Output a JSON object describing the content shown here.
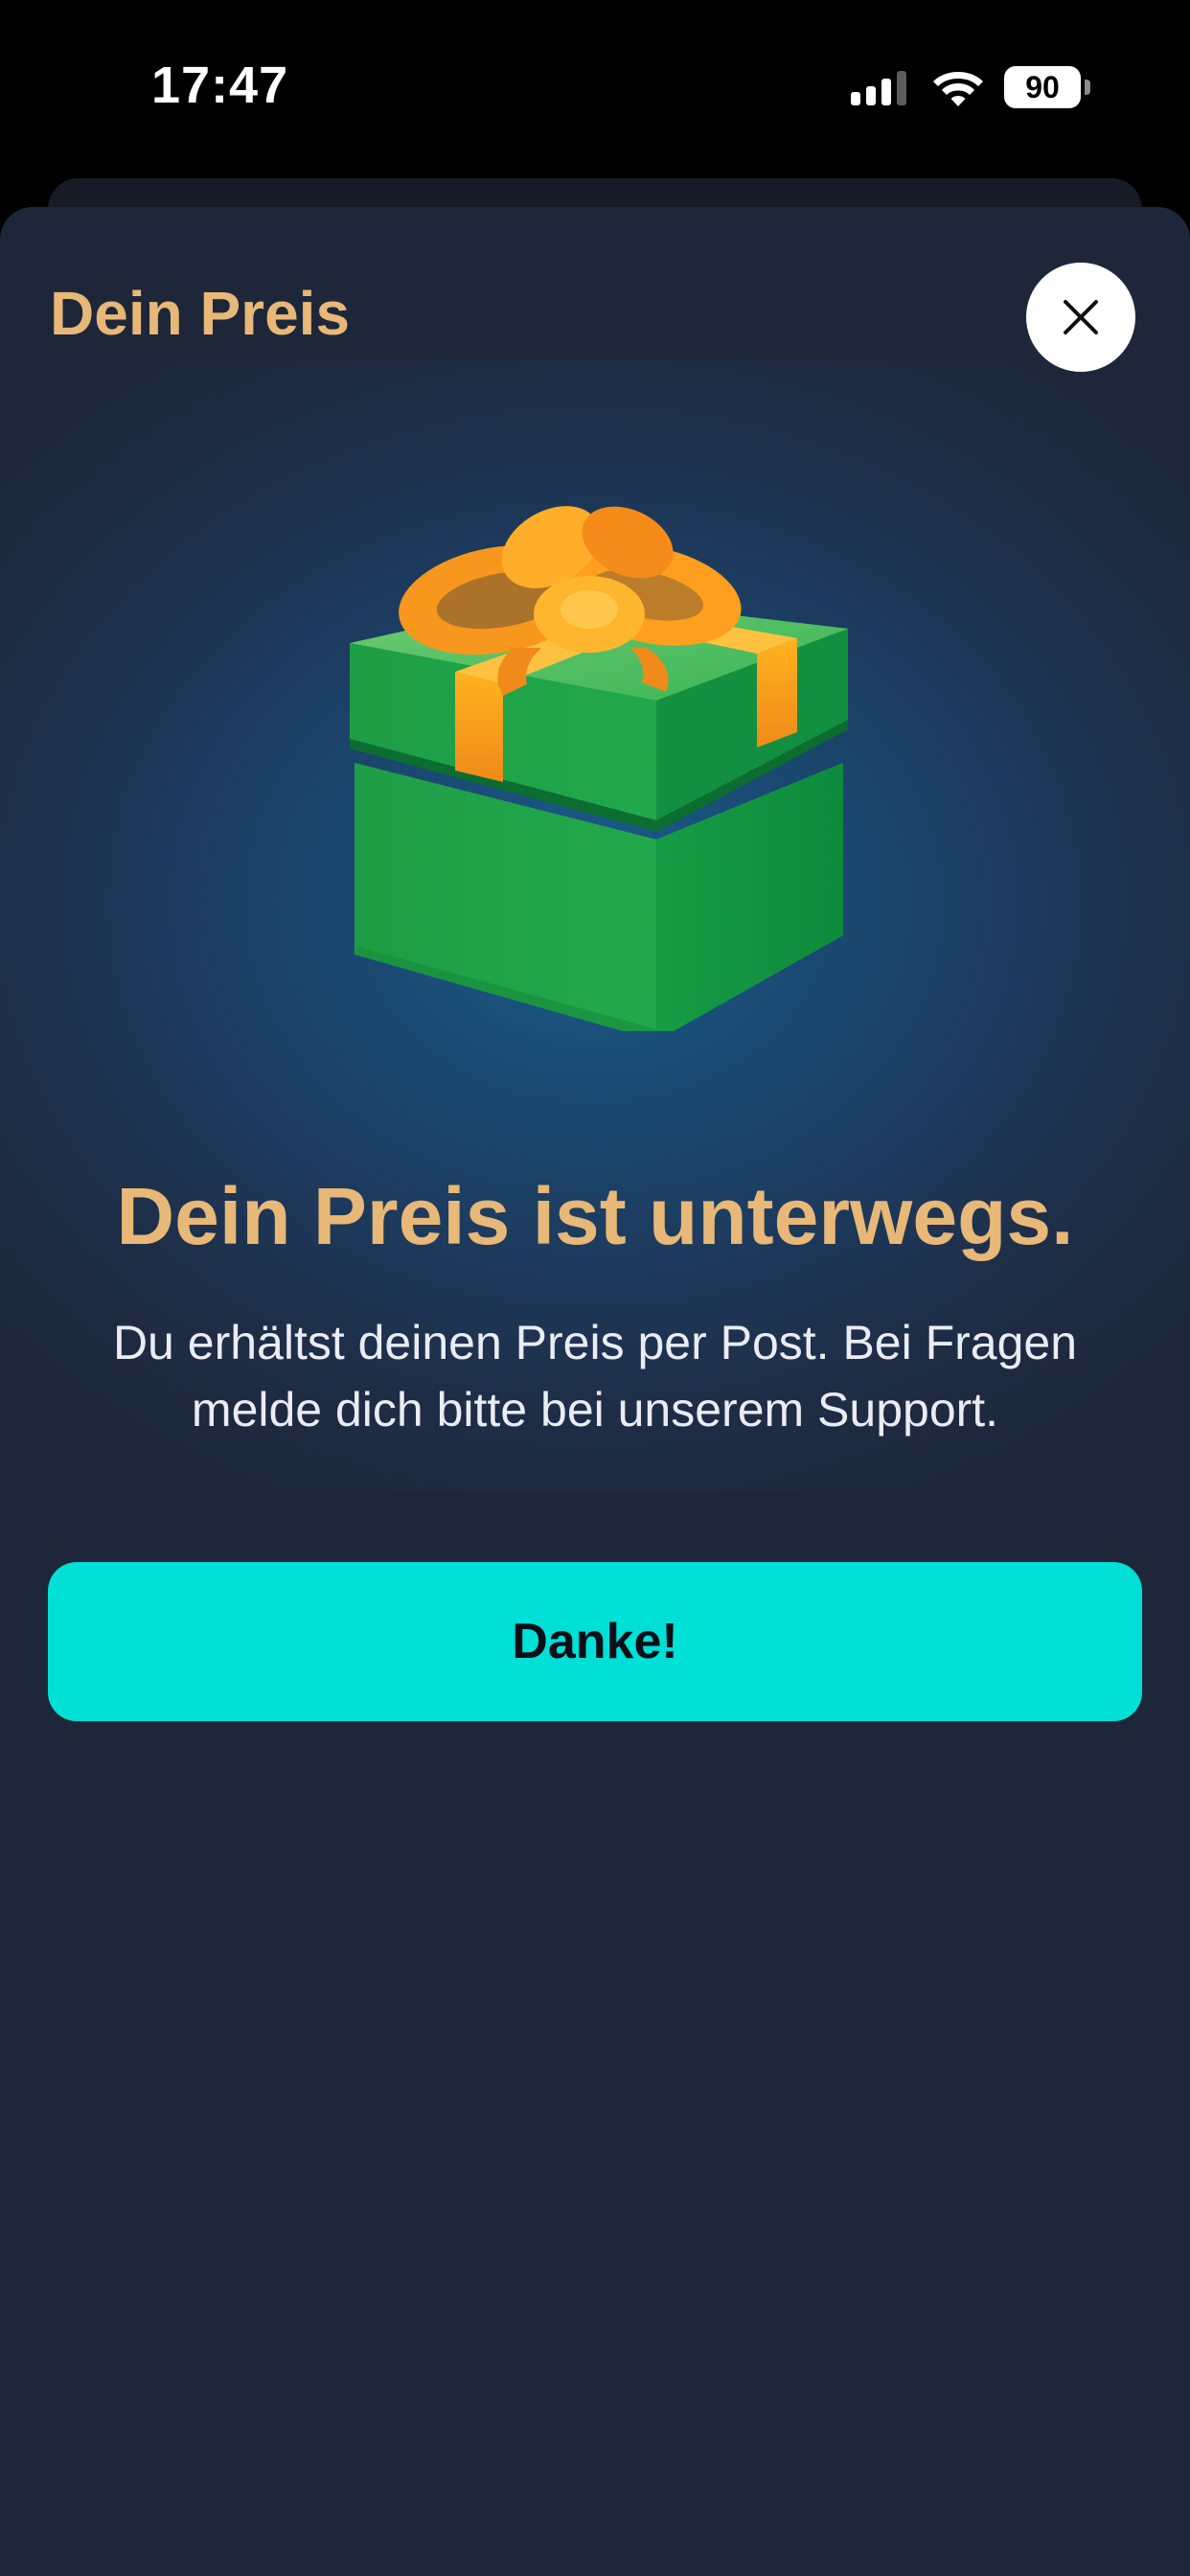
{
  "status_bar": {
    "time": "17:47",
    "battery_level": "90",
    "icons": [
      "cellular-signal-icon",
      "wifi-icon",
      "battery-icon"
    ]
  },
  "modal": {
    "title": "Dein Preis",
    "close_icon": "close-icon",
    "illustration": "gift-box-icon",
    "headline": "Dein Preis ist unterwegs.",
    "description": "Du erhältst deinen Preis per Post. Bei Fragen melde dich bitte bei unserem Support.",
    "button_label": "Danke!"
  },
  "colors": {
    "accent_gold": "#e7b877",
    "button_cyan": "#00e0d6",
    "sheet_background": "#1e273a",
    "gift_green": "#1faa4a",
    "ribbon_orange": "#f7a21b"
  }
}
